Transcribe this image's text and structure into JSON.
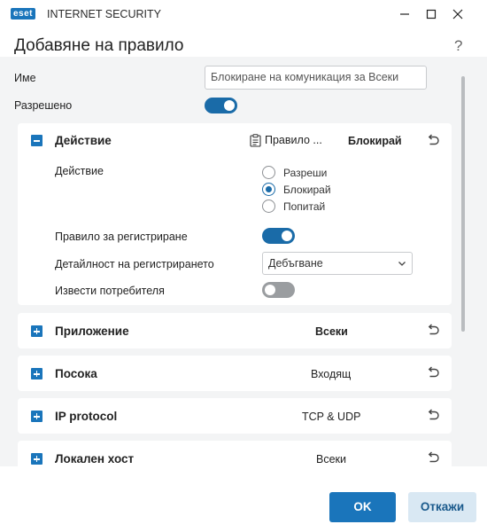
{
  "window": {
    "brand": "eset",
    "product": "INTERNET SECURITY",
    "controls": [
      "minimize-icon",
      "maximize-icon",
      "close-icon"
    ]
  },
  "dialog": {
    "title": "Добавяне на правило",
    "help": "?"
  },
  "fields": {
    "name_label": "Име",
    "name_value": "Блокиране на комуникация за Всеки",
    "enabled_label": "Разрешено",
    "enabled": true
  },
  "action_section": {
    "title": "Действие",
    "rule_label": "Правило ...",
    "value": "Блокирай",
    "action_label": "Действие",
    "options": [
      "Разреши",
      "Блокирай",
      "Попитай"
    ],
    "selected": "Блокирай",
    "log_rule_label": "Правило за регистриране",
    "log_rule": true,
    "verbosity_label": "Детайлност на регистрирането",
    "verbosity_value": "Дебъгване",
    "notify_label": "Извести потребителя",
    "notify": false
  },
  "sections": [
    {
      "title": "Приложение",
      "value": "Всеки",
      "bold": true
    },
    {
      "title": "Посока",
      "value": "Входящ",
      "bold": false
    },
    {
      "title": "IP protocol",
      "value": "TCP & UDP",
      "bold": false
    },
    {
      "title": "Локален хост",
      "value": "Всеки",
      "bold": false
    }
  ],
  "footer": {
    "ok": "OK",
    "cancel": "Откажи"
  },
  "colors": {
    "accent": "#1a75bb",
    "toggle_on": "#1a6ba8",
    "toggle_off": "#9a9da0",
    "panel_bg": "#f3f4f5"
  }
}
